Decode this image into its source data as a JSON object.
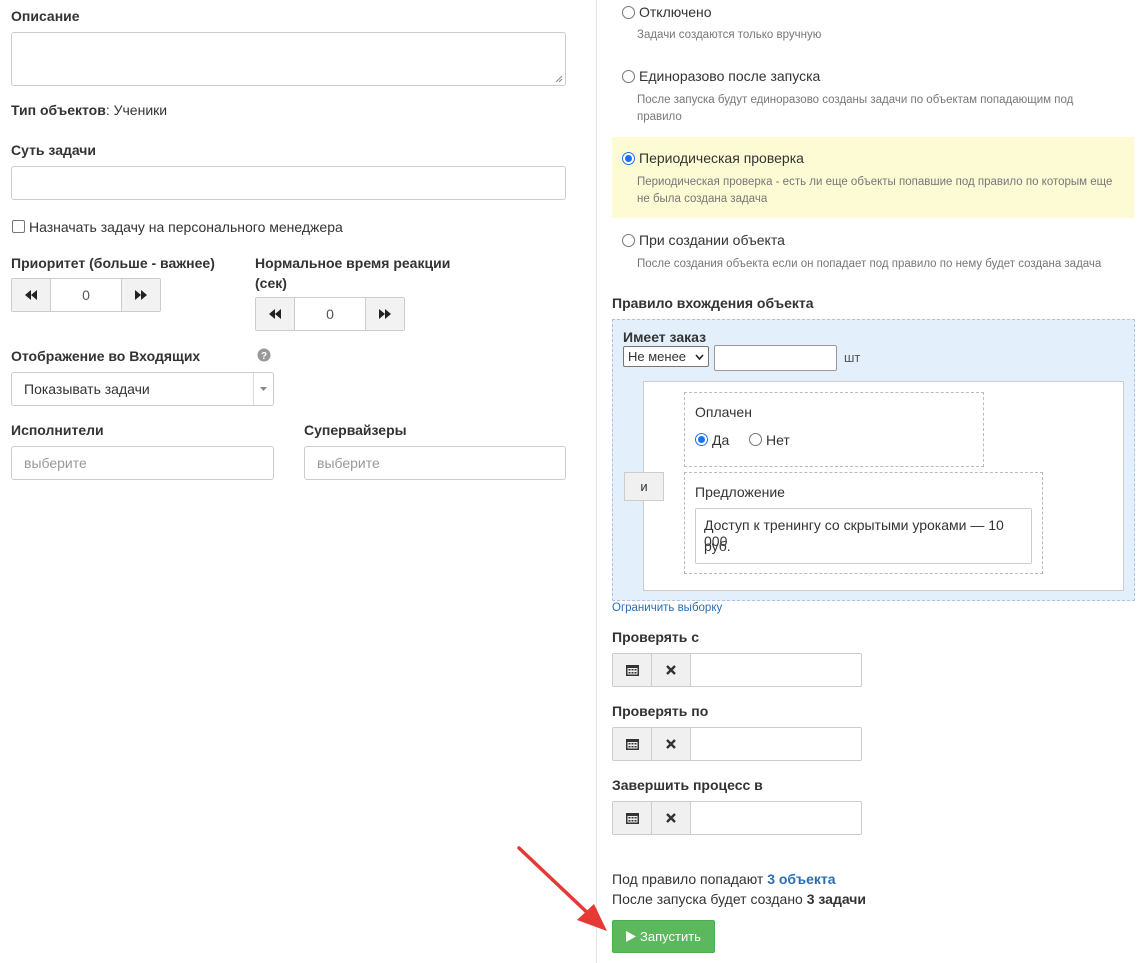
{
  "left": {
    "description_label": "Описание",
    "object_type_label": "Тип объектов",
    "object_type_value": ": Ученики",
    "task_essence_label": "Суть задачи",
    "assign_personal_manager_label": "Назначать задачу на персонального менеджера",
    "priority_label": "Приоритет (больше - важнее)",
    "priority_value": "0",
    "reaction_time_label_line1": "Нормальное время реакции",
    "reaction_time_label_line2": "(сек)",
    "reaction_time_value": "0",
    "inbox_display_label": "Отображение во Входящих",
    "inbox_display_value": "Показывать задачи",
    "executors_label": "Исполнители",
    "executors_placeholder": "выберите",
    "supervisors_label": "Супервайзеры",
    "supervisors_placeholder": "выберите"
  },
  "right": {
    "modes": [
      {
        "title": "Отключено",
        "desc": "Задачи создаются только вручную",
        "selected": false
      },
      {
        "title": "Единоразово после запуска",
        "desc_line1": "После запуска будут единоразово созданы задачи по объектам попадающим под",
        "desc_line2": "правило",
        "selected": false
      },
      {
        "title": "Периодическая проверка",
        "desc_line1": "Периодическая проверка - есть ли еще объекты попавшие под правило по которым еще",
        "desc_line2": "не была создана задача",
        "selected": true
      },
      {
        "title": "При создании объекта",
        "desc": "После создания объекта если он попадает под правило по нему будет создана задача",
        "selected": false
      }
    ],
    "rule_label": "Правило вхождения объекта",
    "has_order_label": "Имеет заказ",
    "condition_select": "Не менее",
    "unit": "шт",
    "and_label": "и",
    "paid_label": "Оплачен",
    "yes_label": "Да",
    "no_label": "Нет",
    "offer_label": "Предложение",
    "offer_value_line1": "Доступ к тренингу со скрытыми уроками — 10 000",
    "offer_value_line2": "руб.",
    "limit_link": "Ограничить выборку",
    "check_from_label": "Проверять с",
    "check_to_label": "Проверять по",
    "finish_label": "Завершить процесс в",
    "summary_prefix": "Под правило попадают ",
    "summary_objects": "3 объекта",
    "summary2_prefix": "После запуска будет создано ",
    "summary2_tasks": "3 задачи",
    "run_button": "Запустить"
  },
  "colors": {
    "accent_blue": "#1a73e8",
    "link_blue": "#2a6db5",
    "highlight_yellow": "#fcfbd4",
    "rule_bg": "#e4effc",
    "run_green": "#5cb85c",
    "arrow_red": "#e53935"
  }
}
